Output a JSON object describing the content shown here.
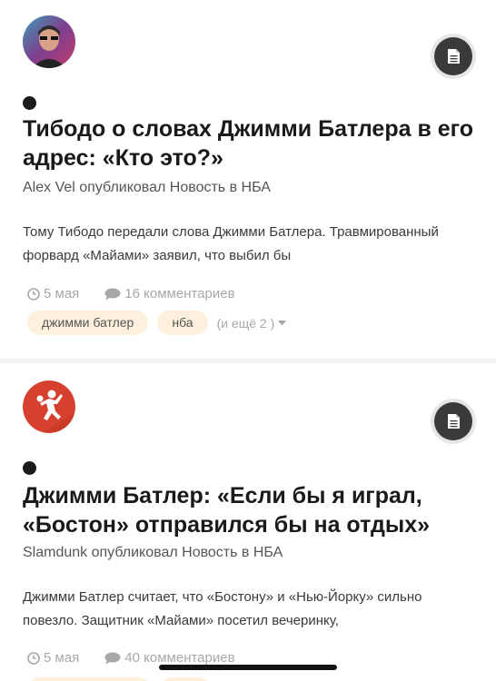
{
  "posts": [
    {
      "title": "Тибодо о словах Джимми Батлера в его адрес: «Кто это?»",
      "byline": "Alex Vel опубликовал Новость в НБА",
      "excerpt": "Тому Тибодо передали слова Джимми Батлера. Травмированный форвард «Майами» заявил, что выбил бы",
      "date": "5 мая",
      "comments": "16 комментариев",
      "tags": [
        "джимми батлер",
        "нба"
      ],
      "more_tags": "(и ещё 2 )"
    },
    {
      "title": "Джимми Батлер: «Если бы я играл, «Бостон» отправился бы на отдых»",
      "byline": "Slamdunk опубликовал Новость в НБА",
      "excerpt": "Джимми Батлер считает, что «Бостону» и «Нью-Йорку» сильно повезло. Защитник «Майами» посетил вечеринку,",
      "date": "5 мая",
      "comments": "40 комментариев",
      "tags": [
        "",
        ""
      ],
      "more_tags": ""
    }
  ],
  "icons": {
    "post_type": "document-icon",
    "date": "clock-icon",
    "comments": "comment-icon",
    "more": "caret-down-icon"
  },
  "colors": {
    "tag_bg": "#fdf0dd",
    "type_button": "#3a3a3a",
    "avatar_2": "#d6402e"
  }
}
